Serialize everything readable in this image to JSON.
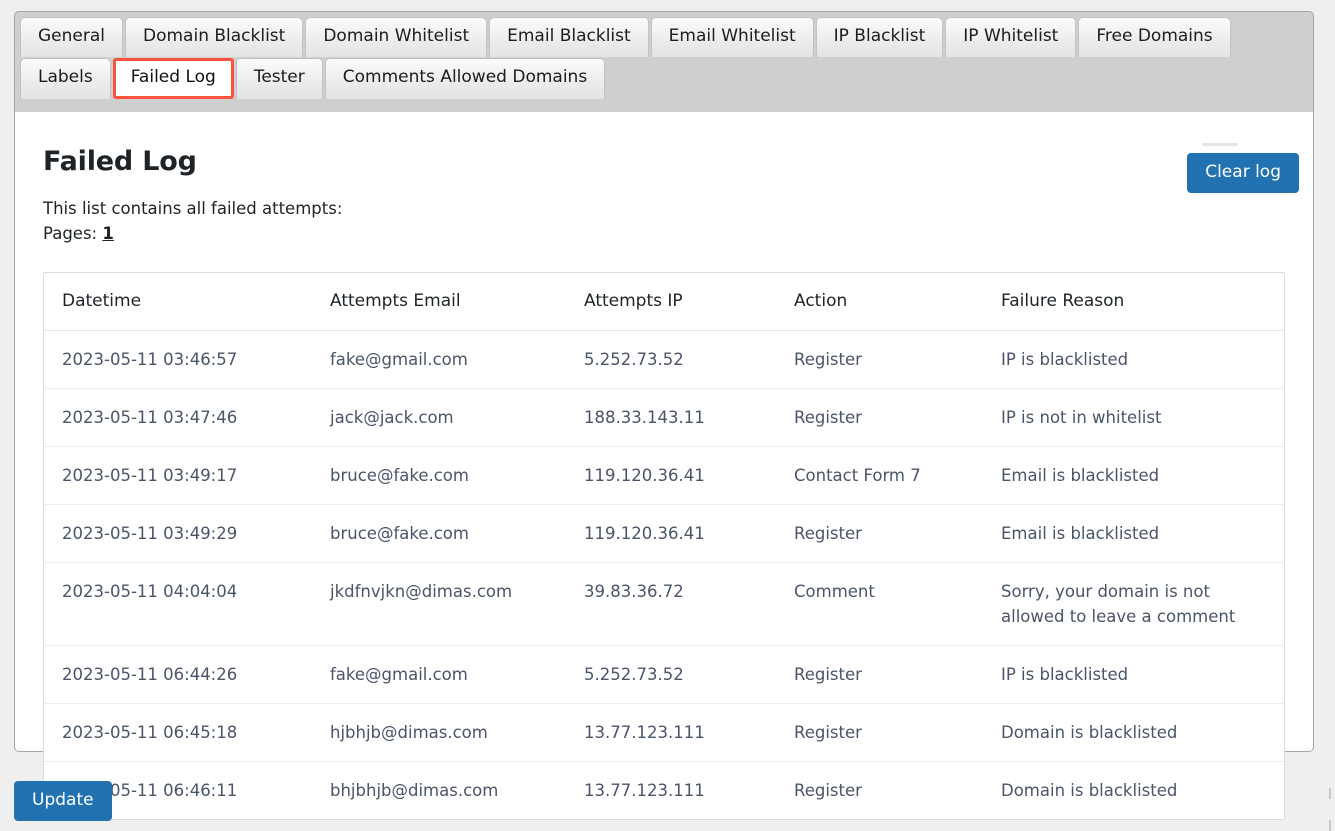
{
  "tabs": {
    "row1": [
      {
        "label": "General",
        "active": false
      },
      {
        "label": "Domain Blacklist",
        "active": false
      },
      {
        "label": "Domain Whitelist",
        "active": false
      },
      {
        "label": "Email Blacklist",
        "active": false
      },
      {
        "label": "Email Whitelist",
        "active": false
      },
      {
        "label": "IP Blacklist",
        "active": false
      },
      {
        "label": "IP Whitelist",
        "active": false
      },
      {
        "label": "Free Domains",
        "active": false
      }
    ],
    "row2": [
      {
        "label": "Labels",
        "active": false
      },
      {
        "label": "Failed Log",
        "active": true
      },
      {
        "label": "Tester",
        "active": false
      },
      {
        "label": "Comments Allowed Domains",
        "active": false
      }
    ]
  },
  "page": {
    "title": "Failed Log",
    "description": "This list contains all failed attempts:",
    "pages_label": "Pages:",
    "pages_current": "1"
  },
  "buttons": {
    "clear_log": "Clear log",
    "update": "Update"
  },
  "colors": {
    "accent_blue": "#2271b1",
    "active_tab_outline": "#f9523f",
    "tabbar_bg": "#cfcfcf",
    "page_bg": "#efefef"
  },
  "table": {
    "columns": [
      "Datetime",
      "Attempts Email",
      "Attempts IP",
      "Action",
      "Failure Reason"
    ],
    "rows": [
      {
        "datetime": "2023-05-11 03:46:57",
        "email": "fake@gmail.com",
        "ip": "5.252.73.52",
        "action": "Register",
        "reason": "IP is blacklisted"
      },
      {
        "datetime": "2023-05-11 03:47:46",
        "email": "jack@jack.com",
        "ip": "188.33.143.11",
        "action": "Register",
        "reason": "IP is not in whitelist"
      },
      {
        "datetime": "2023-05-11 03:49:17",
        "email": "bruce@fake.com",
        "ip": "119.120.36.41",
        "action": "Contact Form 7",
        "reason": "Email is blacklisted"
      },
      {
        "datetime": "2023-05-11 03:49:29",
        "email": "bruce@fake.com",
        "ip": "119.120.36.41",
        "action": "Register",
        "reason": "Email is blacklisted"
      },
      {
        "datetime": "2023-05-11 04:04:04",
        "email": "jkdfnvjkn@dimas.com",
        "ip": "39.83.36.72",
        "action": "Comment",
        "reason": "Sorry, your domain is not allowed to leave a comment"
      },
      {
        "datetime": "2023-05-11 06:44:26",
        "email": "fake@gmail.com",
        "ip": "5.252.73.52",
        "action": "Register",
        "reason": "IP is blacklisted"
      },
      {
        "datetime": "2023-05-11 06:45:18",
        "email": "hjbhjb@dimas.com",
        "ip": "13.77.123.111",
        "action": "Register",
        "reason": "Domain is blacklisted"
      },
      {
        "datetime": "2023-05-11 06:46:11",
        "email": "bhjbhjb@dimas.com",
        "ip": "13.77.123.111",
        "action": "Register",
        "reason": "Domain is blacklisted"
      }
    ]
  }
}
